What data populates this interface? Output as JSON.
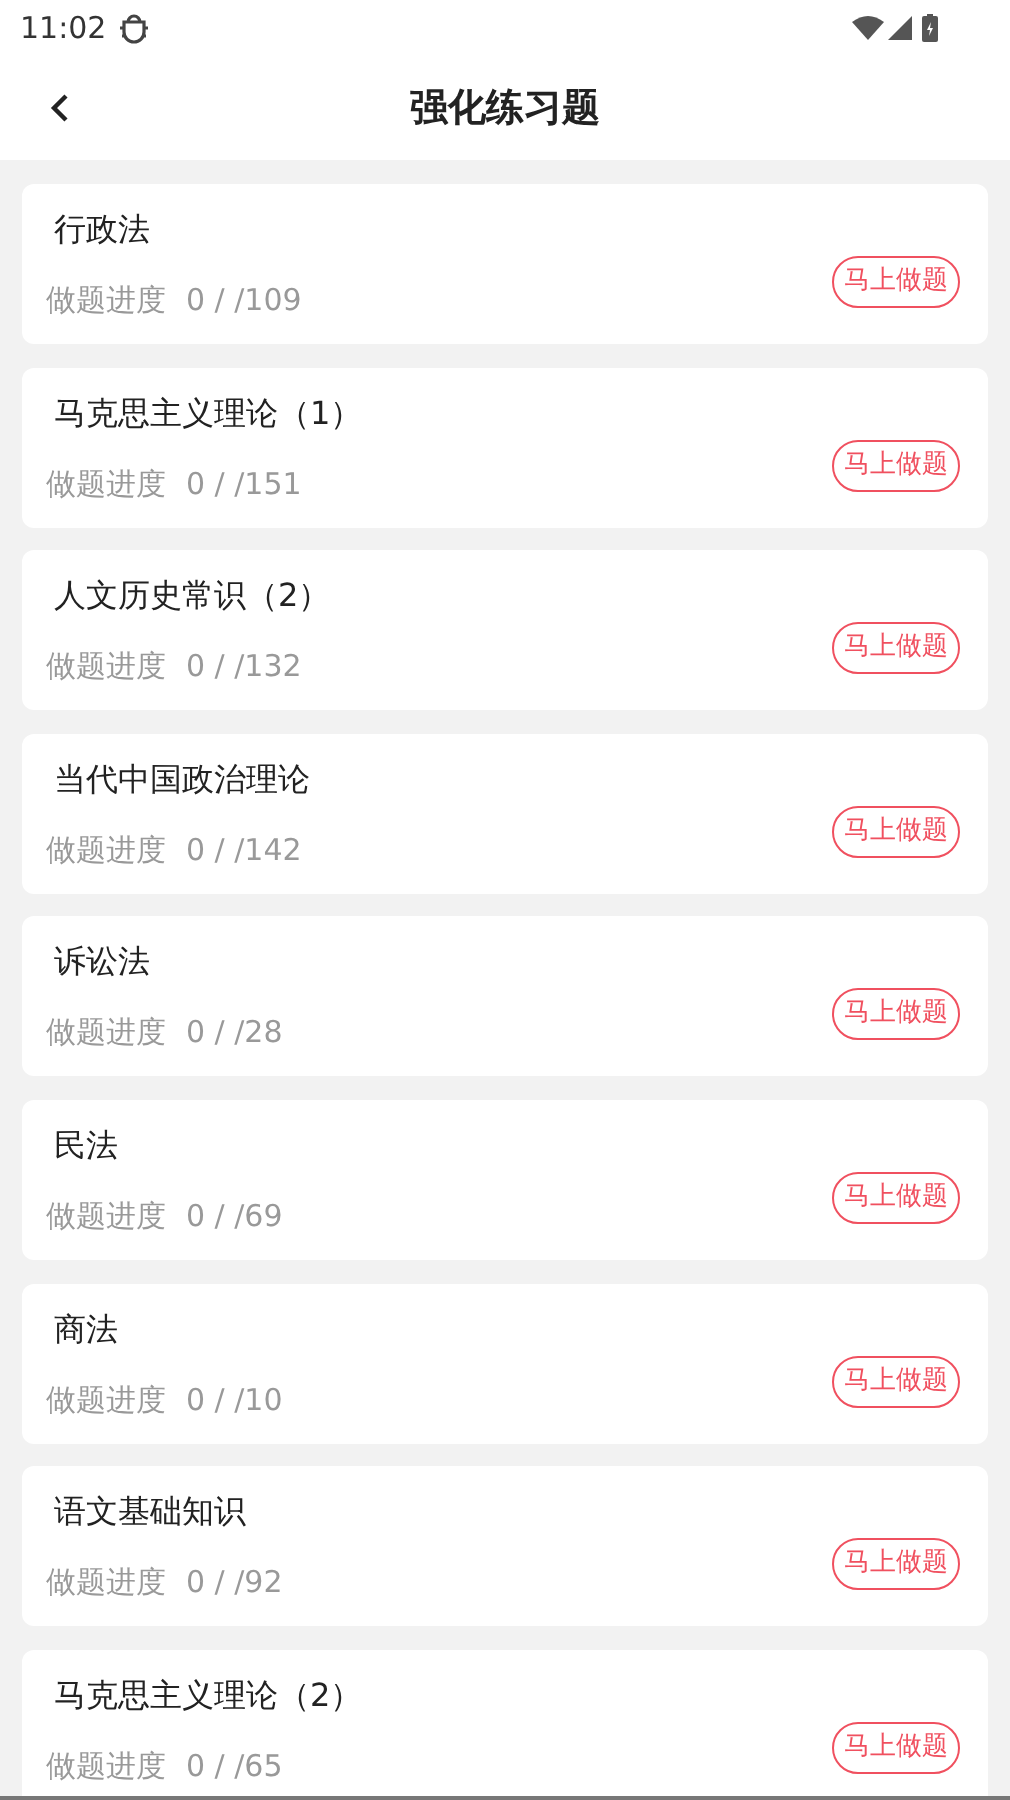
{
  "status_bar": {
    "time": "11:02"
  },
  "header": {
    "title": "强化练习题"
  },
  "items": [
    {
      "title": "行政法",
      "progress_label": "做题进度",
      "progress": "0 / /109",
      "action": "马上做题"
    },
    {
      "title": "马克思主义理论（1）",
      "progress_label": "做题进度",
      "progress": "0 / /151",
      "action": "马上做题"
    },
    {
      "title": "人文历史常识（2）",
      "progress_label": "做题进度",
      "progress": "0 / /132",
      "action": "马上做题"
    },
    {
      "title": "当代中国政治理论",
      "progress_label": "做题进度",
      "progress": "0 / /142",
      "action": "马上做题"
    },
    {
      "title": "诉讼法",
      "progress_label": "做题进度",
      "progress": "0 / /28",
      "action": "马上做题"
    },
    {
      "title": "民法",
      "progress_label": "做题进度",
      "progress": "0 / /69",
      "action": "马上做题"
    },
    {
      "title": "商法",
      "progress_label": "做题进度",
      "progress": "0 / /10",
      "action": "马上做题"
    },
    {
      "title": "语文基础知识",
      "progress_label": "做题进度",
      "progress": "0 / /92",
      "action": "马上做题"
    },
    {
      "title": "马克思主义理论（2）",
      "progress_label": "做题进度",
      "progress": "0 / /65",
      "action": "马上做题"
    }
  ]
}
